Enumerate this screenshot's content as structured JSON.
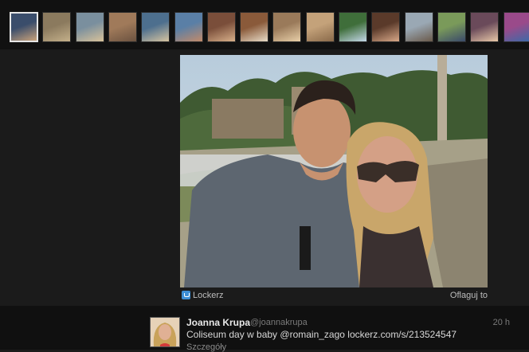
{
  "thumbnails": [
    {
      "name": "thumb-1",
      "colors": [
        "#3a4d6b",
        "#c9a27a"
      ],
      "selected": true
    },
    {
      "name": "thumb-2",
      "colors": [
        "#8b7a5e",
        "#c4b08a"
      ],
      "selected": false
    },
    {
      "name": "thumb-3",
      "colors": [
        "#7a8f9e",
        "#d8c29a"
      ],
      "selected": false
    },
    {
      "name": "thumb-4",
      "colors": [
        "#a07a5a",
        "#6b5240"
      ],
      "selected": false
    },
    {
      "name": "thumb-5",
      "colors": [
        "#4d6f8e",
        "#d6c4a0"
      ],
      "selected": false
    },
    {
      "name": "thumb-6",
      "colors": [
        "#5a7fa6",
        "#c28a6a"
      ],
      "selected": false
    },
    {
      "name": "thumb-7",
      "colors": [
        "#7a4e3a",
        "#d8b08a"
      ],
      "selected": false
    },
    {
      "name": "thumb-8",
      "colors": [
        "#8a5a3a",
        "#e8dcc8"
      ],
      "selected": false
    },
    {
      "name": "thumb-9",
      "colors": [
        "#9a7a5a",
        "#e8cfa8"
      ],
      "selected": false
    },
    {
      "name": "thumb-10",
      "colors": [
        "#c4a27a",
        "#8a6a4a"
      ],
      "selected": false
    },
    {
      "name": "thumb-11",
      "colors": [
        "#3f6e3a",
        "#c4d8e8"
      ],
      "selected": false
    },
    {
      "name": "thumb-12",
      "colors": [
        "#5a3a2a",
        "#d8a888"
      ],
      "selected": false
    },
    {
      "name": "thumb-13",
      "colors": [
        "#9aa8b4",
        "#6a5a4a"
      ],
      "selected": false
    },
    {
      "name": "thumb-14",
      "colors": [
        "#7a9a5a",
        "#3a4a6a"
      ],
      "selected": false
    },
    {
      "name": "thumb-15",
      "colors": [
        "#6a4a5a",
        "#e8c8a8"
      ],
      "selected": false
    },
    {
      "name": "thumb-16",
      "colors": [
        "#9a4a8a",
        "#3a6aa8"
      ],
      "selected": false
    }
  ],
  "photo_bar": {
    "source_label": "Lockerz",
    "flag_label": "Oflaguj to"
  },
  "tweet": {
    "name": "Joanna Krupa",
    "handle": "@joannakrupa",
    "time": "20 h",
    "text_before": "Coliseum day w baby ",
    "mention": "@romain_zago",
    "link": "lockerz.com/s/213524547",
    "details": "Szczegóły"
  },
  "colors": {
    "background": "#1b1b1b",
    "strip": "#111111",
    "accent_icon": "#3d8fd6"
  }
}
